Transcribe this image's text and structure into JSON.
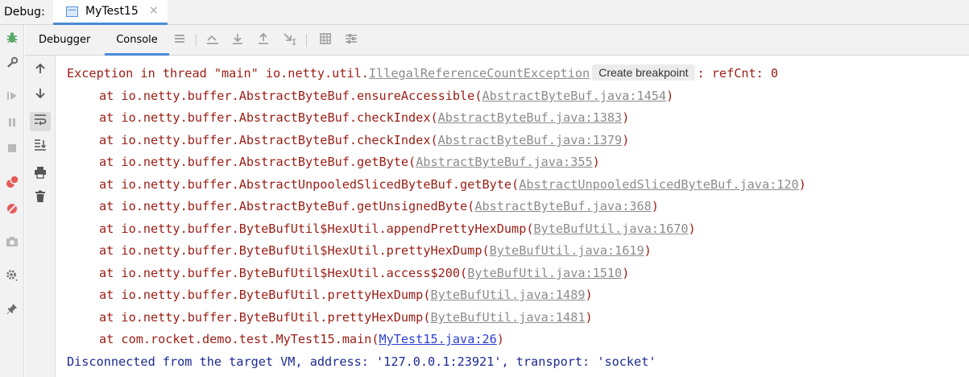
{
  "topbar": {
    "debug_label": "Debug:",
    "tab_label": "MyTest15",
    "tab_close": "×"
  },
  "subtabs": {
    "debugger": "Debugger",
    "console": "Console"
  },
  "console": {
    "exception": {
      "prefix": "Exception in thread \"main\" io.netty.util.",
      "exception_link": "IllegalReferenceCountException",
      "pill": "Create breakpoint",
      "suffix": ": refCnt: 0"
    },
    "frames": [
      {
        "method": "at io.netty.buffer.AbstractByteBuf.ensureAccessible(",
        "loc": "AbstractByteBuf.java:1454",
        "close": ")"
      },
      {
        "method": "at io.netty.buffer.AbstractByteBuf.checkIndex(",
        "loc": "AbstractByteBuf.java:1383",
        "close": ")"
      },
      {
        "method": "at io.netty.buffer.AbstractByteBuf.checkIndex(",
        "loc": "AbstractByteBuf.java:1379",
        "close": ")"
      },
      {
        "method": "at io.netty.buffer.AbstractByteBuf.getByte(",
        "loc": "AbstractByteBuf.java:355",
        "close": ")"
      },
      {
        "method": "at io.netty.buffer.AbstractUnpooledSlicedByteBuf.getByte(",
        "loc": "AbstractUnpooledSlicedByteBuf.java:120",
        "close": ")"
      },
      {
        "method": "at io.netty.buffer.AbstractByteBuf.getUnsignedByte(",
        "loc": "AbstractByteBuf.java:368",
        "close": ")"
      },
      {
        "method": "at io.netty.buffer.ByteBufUtil$HexUtil.appendPrettyHexDump(",
        "loc": "ByteBufUtil.java:1670",
        "close": ")"
      },
      {
        "method": "at io.netty.buffer.ByteBufUtil$HexUtil.prettyHexDump(",
        "loc": "ByteBufUtil.java:1619",
        "close": ")"
      },
      {
        "method": "at io.netty.buffer.ByteBufUtil$HexUtil.access$200(",
        "loc": "ByteBufUtil.java:1510",
        "close": ")"
      },
      {
        "method": "at io.netty.buffer.ByteBufUtil.prettyHexDump(",
        "loc": "ByteBufUtil.java:1489",
        "close": ")"
      },
      {
        "method": "at io.netty.buffer.ByteBufUtil.prettyHexDump(",
        "loc": "ByteBufUtil.java:1481",
        "close": ")"
      },
      {
        "method": "at com.rocket.demo.test.MyTest15.main(",
        "loc": "MyTest15.java:26",
        "close": ")"
      }
    ],
    "disconnected": "Disconnected from the target VM, address: '127.0.0.1:23921', transport: 'socket'"
  },
  "colors": {
    "error": "#9a1c14",
    "info": "#1c2a92",
    "link_gray": "#8c8c8c",
    "link_blue": "#2b3fd1",
    "accent": "#4a8bd6"
  },
  "icons": {
    "left_toolbar": [
      "bug-icon",
      "wrench-icon",
      "resume-icon",
      "pause-icon",
      "stop-icon",
      "view-breakpoints-icon",
      "mute-breakpoints-icon",
      "camera-icon",
      "settings-icon",
      "pin-icon"
    ],
    "sub_toolbar": [
      "layout-icon",
      "show-execution-point-icon",
      "step-over-icon",
      "step-into-icon",
      "step-out-icon",
      "run-to-cursor-icon",
      "evaluate-icon",
      "trace-icon"
    ],
    "console_side": [
      "up-arrow-icon",
      "down-arrow-icon",
      "soft-wrap-icon",
      "scroll-to-end-icon",
      "print-icon",
      "trash-icon"
    ]
  }
}
